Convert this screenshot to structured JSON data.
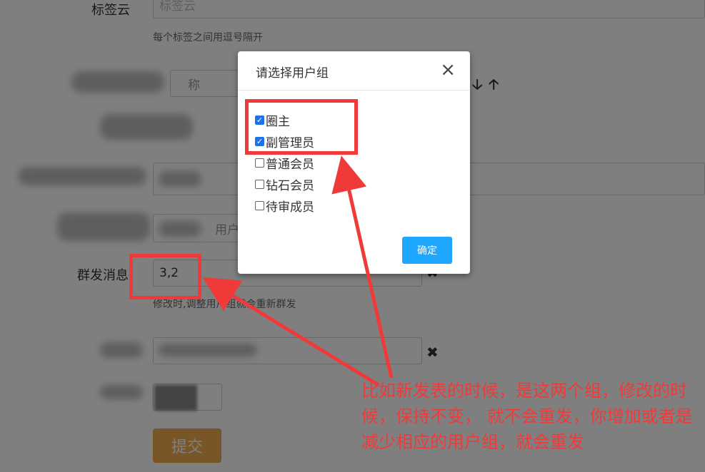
{
  "form": {
    "tagcloud_label": "标签云",
    "tagcloud_placeholder": "标签云",
    "tagcloud_help": "每个标签之间用逗号隔开",
    "partial_field_text": "称",
    "partial_field_text2": "用户",
    "mass_msg_label": "群发消息",
    "mass_msg_value": "3,2",
    "mass_msg_help": "修改时,调整用户组就会重新群发",
    "submit_label": "提交"
  },
  "icons": {
    "arrow_down": "arrow-down-icon",
    "arrow_up": "arrow-up-icon",
    "remove": "times-icon"
  },
  "modal": {
    "title": "请选择用户组",
    "close": "×",
    "options": [
      {
        "label": "圈主",
        "checked": true
      },
      {
        "label": "副管理员",
        "checked": true
      },
      {
        "label": "普通会员",
        "checked": false
      },
      {
        "label": "钻石会员",
        "checked": false
      },
      {
        "label": "待审成员",
        "checked": false
      }
    ],
    "confirm_label": "确定"
  },
  "annotation": {
    "text": "比如新发表的时候，是这两个组，修改的时候，保持不变， 就不会重发，你增加或者是减少相应的用户组，就会重发"
  },
  "colors": {
    "annotation_red": "#f03a3a",
    "confirm_blue": "#1ea7ff",
    "submit_orange": "#f0ad4e"
  }
}
